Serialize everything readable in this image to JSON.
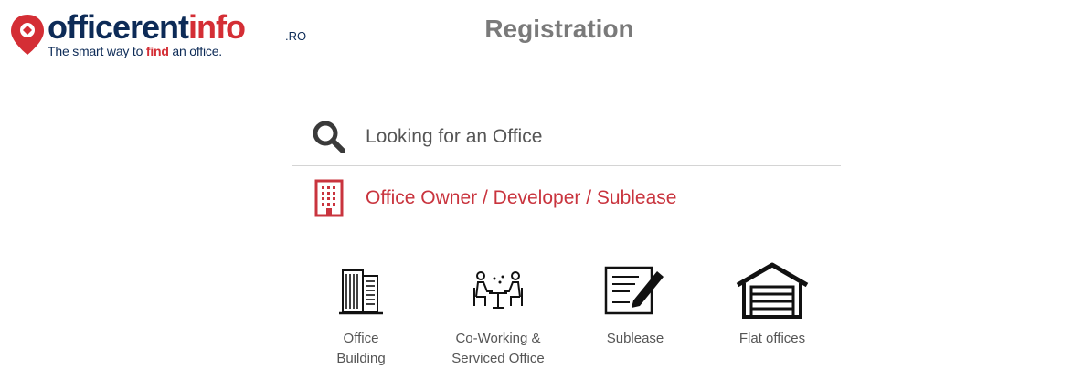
{
  "logo": {
    "word_main": "officerent",
    "word_accent": "info",
    "suffix": ".RO",
    "tagline_pre": "The smart way to ",
    "tagline_find": "find",
    "tagline_post": " an office.",
    "colors": {
      "navy": "#0d2b57",
      "red": "#d42e35"
    }
  },
  "header": {
    "title": "Registration"
  },
  "options": [
    {
      "label": "Looking for an Office",
      "icon": "search-icon"
    },
    {
      "label": "Office Owner / Developer / Sublease",
      "icon": "building-icon",
      "color": "#c9343e"
    }
  ],
  "tiles": [
    {
      "line1": "Office",
      "line2": "Building",
      "icon": "office-building-icon"
    },
    {
      "line1": "Co-Working &",
      "line2": "Serviced Office",
      "icon": "coworking-icon"
    },
    {
      "line1": "Sublease",
      "line2": "",
      "icon": "contract-icon"
    },
    {
      "line1": "Flat offices",
      "line2": "",
      "icon": "garage-icon"
    }
  ]
}
